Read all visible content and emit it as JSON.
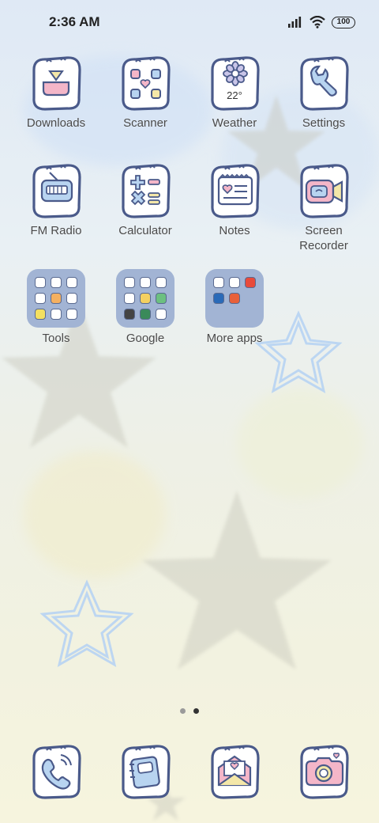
{
  "status_bar": {
    "time": "2:36 AM",
    "battery": "100"
  },
  "apps": [
    {
      "label": "Downloads"
    },
    {
      "label": "Scanner"
    },
    {
      "label": "Weather",
      "temp": "22°"
    },
    {
      "label": "Settings"
    },
    {
      "label": "FM Radio"
    },
    {
      "label": "Calculator"
    },
    {
      "label": "Notes"
    },
    {
      "label": "Screen\nRecorder"
    }
  ],
  "folders": [
    {
      "label": "Tools"
    },
    {
      "label": "Google"
    },
    {
      "label": "More apps"
    }
  ],
  "page_indicator": {
    "pages": 2,
    "current": 2
  },
  "dock": [
    {
      "icon": "phone-icon"
    },
    {
      "icon": "contacts-notebook-icon"
    },
    {
      "icon": "messages-envelope-icon"
    },
    {
      "icon": "camera-icon"
    }
  ],
  "colors": {
    "icon_outline": "#4a5a8a",
    "folder_bg": "#a2b4d4",
    "accent_pink": "#f4b6c8",
    "accent_blue": "#b8d4f0",
    "accent_yellow": "#f4e7a8"
  }
}
